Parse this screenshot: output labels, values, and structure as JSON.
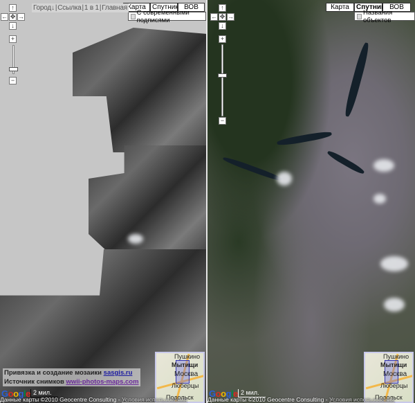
{
  "left_map": {
    "links": [
      "Город↓",
      "Ссылка",
      "1 в 1",
      "Главная"
    ],
    "map_types": [
      {
        "label": "Карта",
        "selected": false
      },
      {
        "label": "Спутник",
        "selected": false
      },
      {
        "label": "ВОВ",
        "selected": true
      }
    ],
    "option_label": "С современными подписями",
    "option_checked": false,
    "credits_line1": "Привязка и создание мозаики",
    "credits_link1": "sasgis.ru",
    "credits_line2": "Источник снимков",
    "credits_link2": "wwii-photos-maps.com",
    "scale": "2 мил.",
    "copyright": "Данные карты ©2010 Geocentre Consulting -",
    "terms": "Условия использования"
  },
  "right_map": {
    "map_types": [
      {
        "label": "Карта",
        "selected": false
      },
      {
        "label": "Спутник",
        "selected": true
      },
      {
        "label": "ВОВ",
        "selected": false
      }
    ],
    "option_label": "Названия объектов",
    "option_checked": false,
    "scale": "2 мил.",
    "copyright": "Данные карты ©2010 Geocentre Consulting -",
    "terms": "Условия использования"
  },
  "nav": {
    "up": "↑",
    "left": "←",
    "center": "✥",
    "right": "→",
    "down": "↓",
    "zoom_in": "+",
    "zoom_out": "−"
  },
  "overview_labels": [
    "Пушкино",
    "Мытищи",
    "Москва",
    "Люберцы",
    "Подольск"
  ],
  "logo": "Google",
  "colors": {
    "overview_box": "#3636b0",
    "roads": "#f2b84a",
    "link": "#1a1aa0"
  }
}
